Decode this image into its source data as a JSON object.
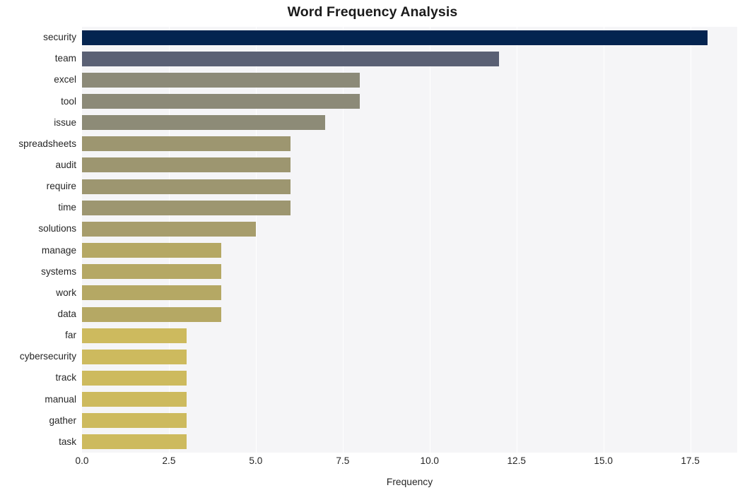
{
  "chart_data": {
    "type": "bar",
    "orientation": "horizontal",
    "title": "Word Frequency Analysis",
    "xlabel": "Frequency",
    "ylabel": "",
    "categories": [
      "security",
      "team",
      "excel",
      "tool",
      "issue",
      "spreadsheets",
      "audit",
      "require",
      "time",
      "solutions",
      "manage",
      "systems",
      "work",
      "data",
      "far",
      "cybersecurity",
      "track",
      "manual",
      "gather",
      "task"
    ],
    "values": [
      18,
      12,
      8,
      8,
      7,
      6,
      6,
      6,
      6,
      5,
      4,
      4,
      4,
      4,
      3,
      3,
      3,
      3,
      3,
      3
    ],
    "xlim": [
      0,
      18.85
    ],
    "xticks": [
      0.0,
      2.5,
      5.0,
      7.5,
      10.0,
      12.5,
      15.0,
      17.5
    ],
    "xtick_labels": [
      "0.0",
      "2.5",
      "5.0",
      "7.5",
      "10.0",
      "12.5",
      "15.0",
      "17.5"
    ],
    "grid": "vertical-white-on-gray",
    "legend": "none",
    "bar_colors": [
      "#042450",
      "#5a6074",
      "#8c8a78",
      "#8c8a78",
      "#8d8b77",
      "#9d9670",
      "#9d9670",
      "#9d9670",
      "#9d9670",
      "#a79d6c",
      "#b5a864",
      "#b5a864",
      "#b5a864",
      "#b5a864",
      "#cdba5e",
      "#cdba5e",
      "#cdba5e",
      "#cdba5e",
      "#cdba5e",
      "#cdba5e"
    ],
    "plot_background": "#f5f5f7",
    "figure_background": "#ffffff"
  }
}
